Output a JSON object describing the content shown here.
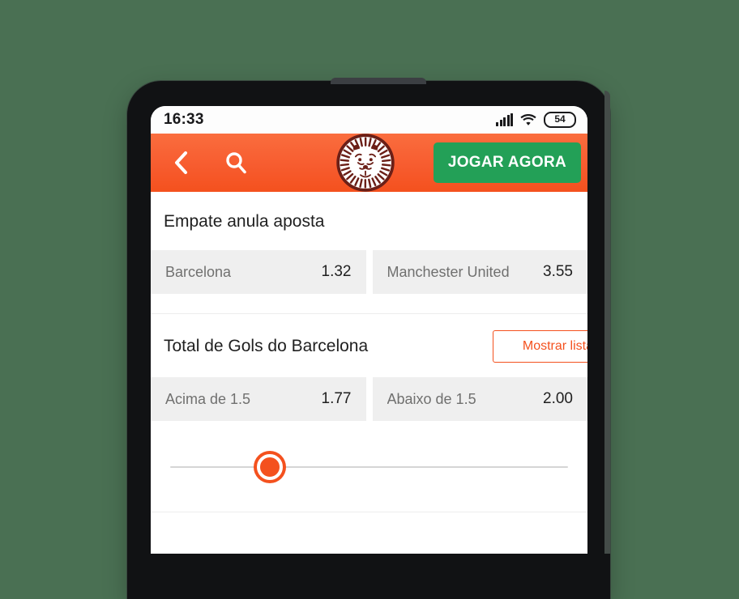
{
  "device": {
    "status_bar": {
      "time": "16:33",
      "signal_icon": "signal-bars-icon",
      "wifi_icon": "wifi-icon",
      "battery_level": "54"
    }
  },
  "app_header": {
    "back_icon": "back-chevron-icon",
    "search_icon": "search-icon",
    "logo_icon": "leovegas-lion-logo",
    "play_now_label": "JOGAR AGORA",
    "play_now_color": "#23a057",
    "header_color": "#f4511e"
  },
  "markets": [
    {
      "title": "Empate anula aposta",
      "has_show_list": false,
      "show_list_label": "",
      "outcomes": [
        {
          "name": "Barcelona",
          "odds": "1.32"
        },
        {
          "name": "Manchester United",
          "odds": "3.55"
        }
      ]
    },
    {
      "title": "Total de Gols do Barcelona",
      "has_show_list": true,
      "show_list_label": "Mostrar lista",
      "outcomes": [
        {
          "name": "Acima de 1.5",
          "odds": "1.77"
        },
        {
          "name": "Abaixo de 1.5",
          "odds": "2.00"
        }
      ]
    }
  ],
  "slider": {
    "position_percent": "25",
    "accent_color": "#f4511e"
  },
  "theme": {
    "page_background": "#4a7053",
    "odds_cell_background": "#efefef",
    "bezel_color": "#111214"
  }
}
